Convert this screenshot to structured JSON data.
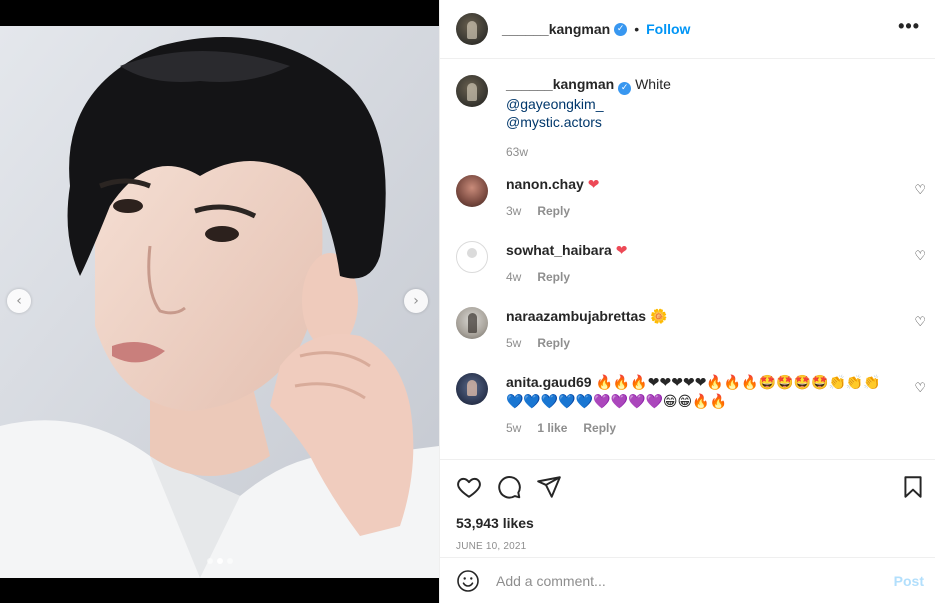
{
  "post": {
    "author": "______kangman",
    "follow_label": "Follow",
    "separator": "•",
    "more_label": "•••",
    "verified_glyph": "✓"
  },
  "caption": {
    "username": "______kangman",
    "text": "White",
    "mentions": [
      "@gayeongkim_",
      "@mystic.actors"
    ],
    "time": "63w"
  },
  "comments": [
    {
      "username": "nanon.chay",
      "text": "❤",
      "time": "3w",
      "likes": "",
      "reply": "Reply"
    },
    {
      "username": "sowhat_haibara",
      "text": "❤",
      "time": "4w",
      "likes": "",
      "reply": "Reply"
    },
    {
      "username": "naraazambujabrettas",
      "text": "🌼",
      "time": "5w",
      "likes": "",
      "reply": "Reply"
    },
    {
      "username": "anita.gaud69",
      "text": "🔥🔥🔥❤❤❤❤❤🔥🔥🔥🤩🤩🤩🤩👏👏👏💙💙💙💙💙💜💜💜💜😁😁🔥🔥",
      "time": "5w",
      "likes": "1 like",
      "reply": "Reply"
    }
  ],
  "stats": {
    "likes": "53,943 likes",
    "date": "JUNE 10, 2021"
  },
  "composer": {
    "placeholder": "Add a comment...",
    "post_label": "Post"
  },
  "carousel": {
    "prev_glyph": "‹",
    "next_glyph": "›",
    "slide_count": 3,
    "active_slide": 2
  },
  "icons": {
    "like": "heart-icon",
    "comment": "comment-icon",
    "share": "paper-plane-icon",
    "save": "bookmark-icon",
    "emoji": "smiley-icon"
  },
  "colors": {
    "link": "#0095f6",
    "mention": "#00376b",
    "verified": "#3897f0",
    "heart_red": "#ed4956",
    "muted": "#8e8e8e"
  }
}
